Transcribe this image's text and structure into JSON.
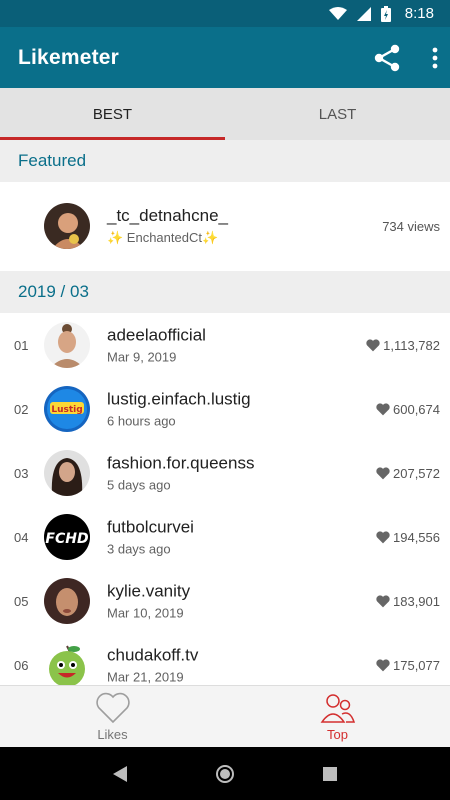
{
  "status": {
    "time": "8:18"
  },
  "app": {
    "title": "Likemeter"
  },
  "tabs": [
    {
      "label": "BEST",
      "active": true
    },
    {
      "label": "LAST",
      "active": false
    }
  ],
  "featured": {
    "header": "Featured",
    "name": "_tc_detnahcne_",
    "subtitle": "✨ EnchantedCt✨",
    "views": "734 views"
  },
  "month": {
    "header": "2019 / 03",
    "rows": [
      {
        "rank": "01",
        "name": "adeelaofficial",
        "date": "Mar 9, 2019",
        "likes": "1,113,782"
      },
      {
        "rank": "02",
        "name": "lustig.einfach.lustig",
        "date": "6 hours ago",
        "likes": "600,674"
      },
      {
        "rank": "03",
        "name": "fashion.for.queenss",
        "date": "5 days ago",
        "likes": "207,572"
      },
      {
        "rank": "04",
        "name": "futbolcurvei",
        "date": "3 days ago",
        "likes": "194,556"
      },
      {
        "rank": "05",
        "name": "kylie.vanity",
        "date": "Mar 10, 2019",
        "likes": "183,901"
      },
      {
        "rank": "06",
        "name": "chudakoff.tv",
        "date": "Mar 21, 2019",
        "likes": "175,077"
      }
    ]
  },
  "bottom_nav": [
    {
      "label": "Likes",
      "icon": "heart-outline-icon",
      "active": false
    },
    {
      "label": "Top",
      "icon": "people-icon",
      "active": true
    }
  ],
  "colors": {
    "primary": "#0a6f8a",
    "status_bar": "#0a5f78",
    "accent": "#d32f2f"
  },
  "avatar_logos": {
    "row_04": "FCHD",
    "row_02": "Lustig"
  }
}
